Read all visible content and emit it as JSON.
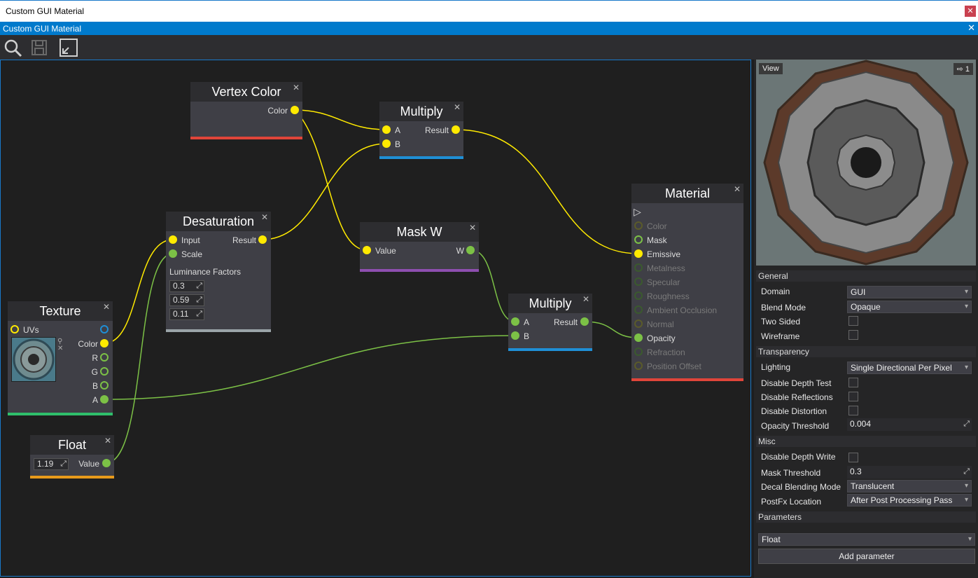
{
  "window": {
    "title": "Custom GUI Material",
    "close_icon": "close-icon"
  },
  "tab": {
    "label": "Custom GUI Material",
    "close": "✕"
  },
  "toolbar": {
    "icons": [
      "search-icon",
      "save-icon",
      "fit-view-icon"
    ]
  },
  "colors": {
    "accent": "#007acc",
    "yellow_pin": "#ffea00",
    "green_pin": "#7cc146",
    "red_bar": "#e0453a",
    "blue_bar": "#1f8fd6",
    "purple_bar": "#8e4fb0",
    "orange_bar": "#e89a1b",
    "green_bar": "#2fbf6b",
    "gray_bar": "#9aa4a8"
  },
  "nodes": {
    "vertex_color": {
      "title": "Vertex Color",
      "out": "Color"
    },
    "multiply1": {
      "title": "Multiply",
      "a": "A",
      "b": "B",
      "out": "Result"
    },
    "desaturation": {
      "title": "Desaturation",
      "input": "Input",
      "scale": "Scale",
      "out": "Result",
      "lum_label": "Luminance Factors",
      "lum": [
        "0.3",
        "0.59",
        "0.11"
      ]
    },
    "mask_w": {
      "title": "Mask W",
      "in": "Value",
      "out": "W"
    },
    "multiply2": {
      "title": "Multiply",
      "a": "A",
      "b": "B",
      "out": "Result"
    },
    "texture": {
      "title": "Texture",
      "uvs": "UVs",
      "color": "Color",
      "r": "R",
      "g": "G",
      "b": "B",
      "a": "A"
    },
    "float": {
      "title": "Float",
      "value": "1.19",
      "out": "Value"
    },
    "material": {
      "title": "Material",
      "pins": [
        "Color",
        "Mask",
        "Emissive",
        "Metalness",
        "Specular",
        "Roughness",
        "Ambient Occlusion",
        "Normal",
        "Opacity",
        "Refraction",
        "Position Offset"
      ]
    }
  },
  "preview": {
    "view_label": "View",
    "count": "1"
  },
  "props": {
    "general": "General",
    "domain_label": "Domain",
    "domain_value": "GUI",
    "blend_label": "Blend Mode",
    "blend_value": "Opaque",
    "two_sided": "Two Sided",
    "wireframe": "Wireframe",
    "transparency": "Transparency",
    "lighting_label": "Lighting",
    "lighting_value": "Single Directional Per Pixel",
    "disable_depth_test": "Disable Depth Test",
    "disable_reflections": "Disable Reflections",
    "disable_distortion": "Disable Distortion",
    "opacity_threshold_label": "Opacity Threshold",
    "opacity_threshold_value": "0.004",
    "misc": "Misc",
    "disable_depth_write": "Disable Depth Write",
    "mask_threshold_label": "Mask Threshold",
    "mask_threshold_value": "0.3",
    "decal_label": "Decal Blending Mode",
    "decal_value": "Translucent",
    "postfx_label": "PostFx Location",
    "postfx_value": "After Post Processing Pass",
    "parameters": "Parameters",
    "param_type": "Float",
    "add_param": "Add parameter"
  }
}
